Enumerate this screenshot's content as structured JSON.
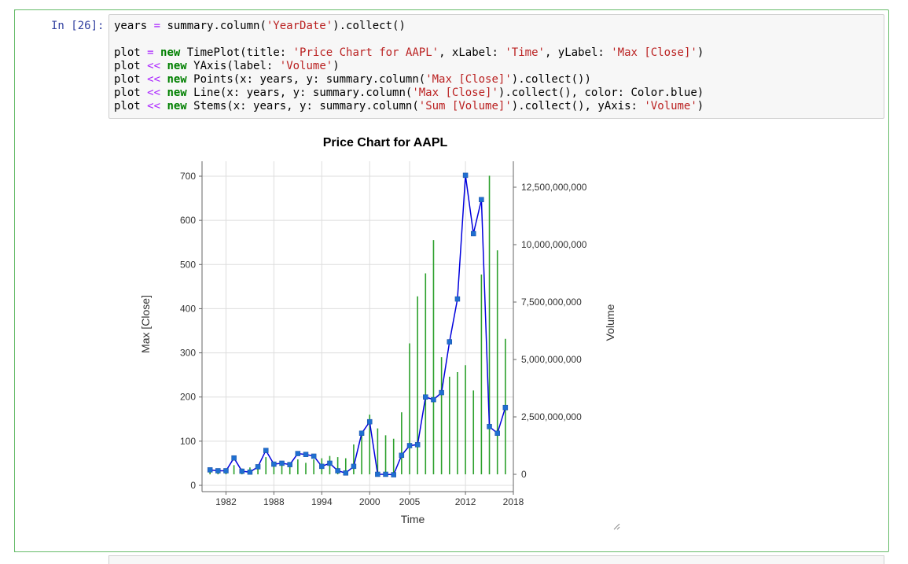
{
  "cell": {
    "prompt": "In [26]:",
    "code_lines": [
      [
        {
          "t": "years "
        },
        {
          "t": "=",
          "c": "op"
        },
        {
          "t": " summary.column("
        },
        {
          "t": "'YearDate'",
          "c": "str"
        },
        {
          "t": ").collect()"
        }
      ],
      [],
      [
        {
          "t": "plot "
        },
        {
          "t": "=",
          "c": "op"
        },
        {
          "t": " "
        },
        {
          "t": "new",
          "c": "kw"
        },
        {
          "t": " TimePlot(title: "
        },
        {
          "t": "'Price Chart for AAPL'",
          "c": "str"
        },
        {
          "t": ", xLabel: "
        },
        {
          "t": "'Time'",
          "c": "str"
        },
        {
          "t": ", yLabel: "
        },
        {
          "t": "'Max [Close]'",
          "c": "str"
        },
        {
          "t": ")"
        }
      ],
      [
        {
          "t": "plot "
        },
        {
          "t": "<<",
          "c": "op"
        },
        {
          "t": " "
        },
        {
          "t": "new",
          "c": "kw"
        },
        {
          "t": " YAxis(label: "
        },
        {
          "t": "'Volume'",
          "c": "str"
        },
        {
          "t": ")"
        }
      ],
      [
        {
          "t": "plot "
        },
        {
          "t": "<<",
          "c": "op"
        },
        {
          "t": " "
        },
        {
          "t": "new",
          "c": "kw"
        },
        {
          "t": " Points(x: years, y: summary.column("
        },
        {
          "t": "'Max [Close]'",
          "c": "str"
        },
        {
          "t": ").collect())"
        }
      ],
      [
        {
          "t": "plot "
        },
        {
          "t": "<<",
          "c": "op"
        },
        {
          "t": " "
        },
        {
          "t": "new",
          "c": "kw"
        },
        {
          "t": " Line(x: years, y: summary.column("
        },
        {
          "t": "'Max [Close]'",
          "c": "str"
        },
        {
          "t": ").collect(), color: Color.blue)"
        }
      ],
      [
        {
          "t": "plot "
        },
        {
          "t": "<<",
          "c": "op"
        },
        {
          "t": " "
        },
        {
          "t": "new",
          "c": "kw"
        },
        {
          "t": " Stems(x: years, y: summary.column("
        },
        {
          "t": "'Sum [Volume]'",
          "c": "str"
        },
        {
          "t": ").collect(), yAxis: "
        },
        {
          "t": "'Volume'",
          "c": "str"
        },
        {
          "t": ")"
        }
      ]
    ]
  },
  "colors": {
    "cell_border": "#66bb6a",
    "prompt": "#303f9f",
    "keyword": "#008000",
    "operator": "#aa22ff",
    "string": "#ba2121",
    "line": "#0000dd",
    "points": "#1f6fd1",
    "stems": "#2ca02c"
  },
  "chart_data": {
    "type": "line",
    "title": "Price Chart for AAPL",
    "xlabel": "Time",
    "ylabel": "Max [Close]",
    "y2label": "Volume",
    "x_ticks": [
      "1982",
      "1988",
      "1994",
      "2000",
      "2005",
      "2012",
      "2018"
    ],
    "y_ticks": [
      "0",
      "100",
      "200",
      "300",
      "400",
      "500",
      "600",
      "700"
    ],
    "y2_ticks": [
      "0",
      "2,500,000,000",
      "5,000,000,000",
      "7,500,000,000",
      "10,000,000,000",
      "12,500,000,000"
    ],
    "xlim": [
      1979,
      2018
    ],
    "ylim": [
      0,
      700
    ],
    "y2lim": [
      0,
      12500000000
    ],
    "grid": true,
    "x": [
      1980,
      1981,
      1982,
      1983,
      1984,
      1985,
      1986,
      1987,
      1988,
      1989,
      1990,
      1991,
      1992,
      1993,
      1994,
      1995,
      1996,
      1997,
      1998,
      1999,
      2000,
      2001,
      2002,
      2003,
      2004,
      2005,
      2006,
      2007,
      2008,
      2009,
      2010,
      2011,
      2012,
      2013,
      2014,
      2015,
      2016,
      2017
    ],
    "series": [
      {
        "name": "Max [Close]",
        "kind": "line+points",
        "values": [
          35,
          33,
          33,
          62,
          32,
          30,
          42,
          79,
          48,
          50,
          47,
          72,
          70,
          66,
          43,
          50,
          33,
          28,
          43,
          118,
          144,
          25,
          25,
          24,
          68,
          90,
          92,
          200,
          194,
          210,
          325,
          422,
          702,
          570,
          647,
          133,
          118,
          176
        ]
      },
      {
        "name": "Sum [Volume]",
        "kind": "stems",
        "axis": "right",
        "values": [
          100000000,
          150000000,
          250000000,
          400000000,
          250000000,
          300000000,
          400000000,
          750000000,
          400000000,
          500000000,
          450000000,
          650000000,
          500000000,
          650000000,
          700000000,
          800000000,
          750000000,
          700000000,
          1300000000,
          1800000000,
          2600000000,
          2000000000,
          1700000000,
          1550000000,
          2700000000,
          5700000000,
          7750000000,
          8750000000,
          10200000000,
          5100000000,
          4250000000,
          4450000000,
          4750000000,
          3650000000,
          8700000000,
          13000000000,
          9750000000,
          5900000000
        ]
      }
    ]
  }
}
